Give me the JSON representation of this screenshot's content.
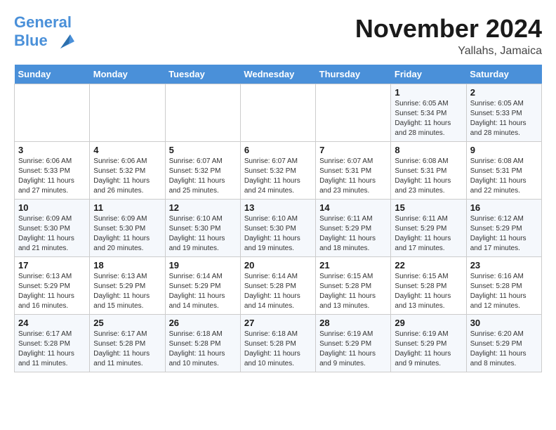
{
  "header": {
    "logo_line1": "General",
    "logo_line2": "Blue",
    "month": "November 2024",
    "location": "Yallahs, Jamaica"
  },
  "weekdays": [
    "Sunday",
    "Monday",
    "Tuesday",
    "Wednesday",
    "Thursday",
    "Friday",
    "Saturday"
  ],
  "weeks": [
    [
      {
        "day": "",
        "info": ""
      },
      {
        "day": "",
        "info": ""
      },
      {
        "day": "",
        "info": ""
      },
      {
        "day": "",
        "info": ""
      },
      {
        "day": "",
        "info": ""
      },
      {
        "day": "1",
        "info": "Sunrise: 6:05 AM\nSunset: 5:34 PM\nDaylight: 11 hours and 28 minutes."
      },
      {
        "day": "2",
        "info": "Sunrise: 6:05 AM\nSunset: 5:33 PM\nDaylight: 11 hours and 28 minutes."
      }
    ],
    [
      {
        "day": "3",
        "info": "Sunrise: 6:06 AM\nSunset: 5:33 PM\nDaylight: 11 hours and 27 minutes."
      },
      {
        "day": "4",
        "info": "Sunrise: 6:06 AM\nSunset: 5:32 PM\nDaylight: 11 hours and 26 minutes."
      },
      {
        "day": "5",
        "info": "Sunrise: 6:07 AM\nSunset: 5:32 PM\nDaylight: 11 hours and 25 minutes."
      },
      {
        "day": "6",
        "info": "Sunrise: 6:07 AM\nSunset: 5:32 PM\nDaylight: 11 hours and 24 minutes."
      },
      {
        "day": "7",
        "info": "Sunrise: 6:07 AM\nSunset: 5:31 PM\nDaylight: 11 hours and 23 minutes."
      },
      {
        "day": "8",
        "info": "Sunrise: 6:08 AM\nSunset: 5:31 PM\nDaylight: 11 hours and 23 minutes."
      },
      {
        "day": "9",
        "info": "Sunrise: 6:08 AM\nSunset: 5:31 PM\nDaylight: 11 hours and 22 minutes."
      }
    ],
    [
      {
        "day": "10",
        "info": "Sunrise: 6:09 AM\nSunset: 5:30 PM\nDaylight: 11 hours and 21 minutes."
      },
      {
        "day": "11",
        "info": "Sunrise: 6:09 AM\nSunset: 5:30 PM\nDaylight: 11 hours and 20 minutes."
      },
      {
        "day": "12",
        "info": "Sunrise: 6:10 AM\nSunset: 5:30 PM\nDaylight: 11 hours and 19 minutes."
      },
      {
        "day": "13",
        "info": "Sunrise: 6:10 AM\nSunset: 5:30 PM\nDaylight: 11 hours and 19 minutes."
      },
      {
        "day": "14",
        "info": "Sunrise: 6:11 AM\nSunset: 5:29 PM\nDaylight: 11 hours and 18 minutes."
      },
      {
        "day": "15",
        "info": "Sunrise: 6:11 AM\nSunset: 5:29 PM\nDaylight: 11 hours and 17 minutes."
      },
      {
        "day": "16",
        "info": "Sunrise: 6:12 AM\nSunset: 5:29 PM\nDaylight: 11 hours and 17 minutes."
      }
    ],
    [
      {
        "day": "17",
        "info": "Sunrise: 6:13 AM\nSunset: 5:29 PM\nDaylight: 11 hours and 16 minutes."
      },
      {
        "day": "18",
        "info": "Sunrise: 6:13 AM\nSunset: 5:29 PM\nDaylight: 11 hours and 15 minutes."
      },
      {
        "day": "19",
        "info": "Sunrise: 6:14 AM\nSunset: 5:29 PM\nDaylight: 11 hours and 14 minutes."
      },
      {
        "day": "20",
        "info": "Sunrise: 6:14 AM\nSunset: 5:28 PM\nDaylight: 11 hours and 14 minutes."
      },
      {
        "day": "21",
        "info": "Sunrise: 6:15 AM\nSunset: 5:28 PM\nDaylight: 11 hours and 13 minutes."
      },
      {
        "day": "22",
        "info": "Sunrise: 6:15 AM\nSunset: 5:28 PM\nDaylight: 11 hours and 13 minutes."
      },
      {
        "day": "23",
        "info": "Sunrise: 6:16 AM\nSunset: 5:28 PM\nDaylight: 11 hours and 12 minutes."
      }
    ],
    [
      {
        "day": "24",
        "info": "Sunrise: 6:17 AM\nSunset: 5:28 PM\nDaylight: 11 hours and 11 minutes."
      },
      {
        "day": "25",
        "info": "Sunrise: 6:17 AM\nSunset: 5:28 PM\nDaylight: 11 hours and 11 minutes."
      },
      {
        "day": "26",
        "info": "Sunrise: 6:18 AM\nSunset: 5:28 PM\nDaylight: 11 hours and 10 minutes."
      },
      {
        "day": "27",
        "info": "Sunrise: 6:18 AM\nSunset: 5:28 PM\nDaylight: 11 hours and 10 minutes."
      },
      {
        "day": "28",
        "info": "Sunrise: 6:19 AM\nSunset: 5:29 PM\nDaylight: 11 hours and 9 minutes."
      },
      {
        "day": "29",
        "info": "Sunrise: 6:19 AM\nSunset: 5:29 PM\nDaylight: 11 hours and 9 minutes."
      },
      {
        "day": "30",
        "info": "Sunrise: 6:20 AM\nSunset: 5:29 PM\nDaylight: 11 hours and 8 minutes."
      }
    ]
  ]
}
